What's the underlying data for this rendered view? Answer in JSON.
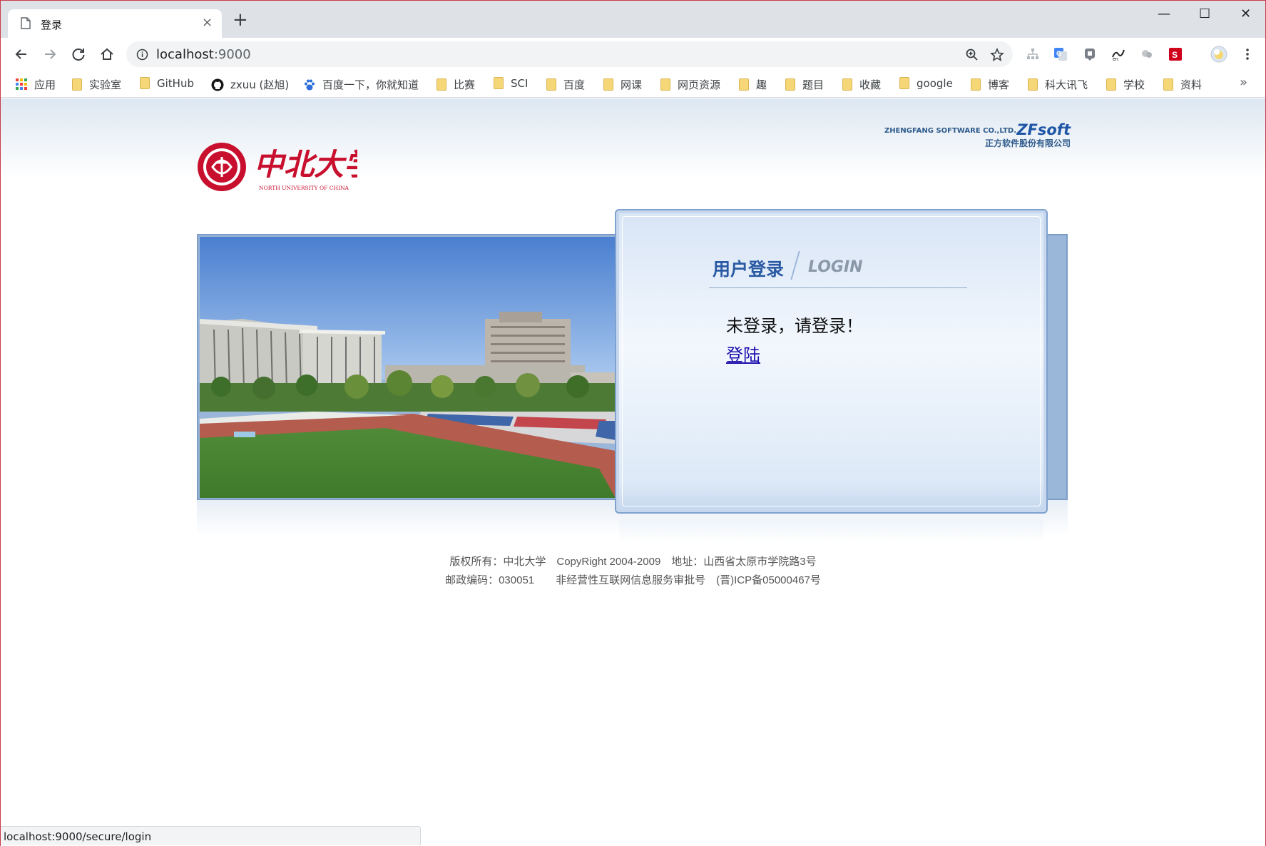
{
  "tab": {
    "title": "登录",
    "close": "×",
    "new_tab": "+"
  },
  "window": {
    "minimize": "—",
    "maximize": "☐",
    "close": "✕"
  },
  "omnibox": {
    "host": "localhost",
    "port": ":9000"
  },
  "bookmarks": [
    {
      "label": "应用",
      "kind": "apps"
    },
    {
      "label": "实验室",
      "kind": "folder"
    },
    {
      "label": "GitHub",
      "kind": "folder"
    },
    {
      "label": "zxuu (赵旭)",
      "kind": "github"
    },
    {
      "label": "百度一下，你就知道",
      "kind": "baidu"
    },
    {
      "label": "比赛",
      "kind": "folder"
    },
    {
      "label": "SCI",
      "kind": "folder"
    },
    {
      "label": "百度",
      "kind": "folder"
    },
    {
      "label": "网课",
      "kind": "folder"
    },
    {
      "label": "网页资源",
      "kind": "folder"
    },
    {
      "label": "趣",
      "kind": "folder"
    },
    {
      "label": "题目",
      "kind": "folder"
    },
    {
      "label": "收藏",
      "kind": "folder"
    },
    {
      "label": "google",
      "kind": "folder"
    },
    {
      "label": "博客",
      "kind": "folder"
    },
    {
      "label": "科大讯飞",
      "kind": "folder"
    },
    {
      "label": "学校",
      "kind": "folder"
    },
    {
      "label": "资料",
      "kind": "folder"
    }
  ],
  "bookmarks_more": "»",
  "header": {
    "university_name": "中北大学",
    "university_name_en": "NORTH UNIVERSITY OF CHINA",
    "vendor_en": "ZHENGFANG SOFTWARE CO.,LTD.",
    "vendor_brand": "ZFsoft",
    "vendor_cn": "正方软件股份有限公司"
  },
  "login": {
    "title": "用户登录",
    "title_en": "LOGIN",
    "message": "未登录，请登录！",
    "link": "登陆"
  },
  "footer": {
    "line1": "版权所有：中北大学　CopyRight 2004-2009　地址：山西省太原市学院路3号",
    "line2": "邮政编码：030051　　非经营性互联网信息服务审批号　(晋)ICP备05000467号"
  },
  "status_url": "localhost:9000/secure/login",
  "colors": {
    "accent": "#2a5aa3",
    "frame": "#c93b4b",
    "university_red": "#c8102e"
  }
}
